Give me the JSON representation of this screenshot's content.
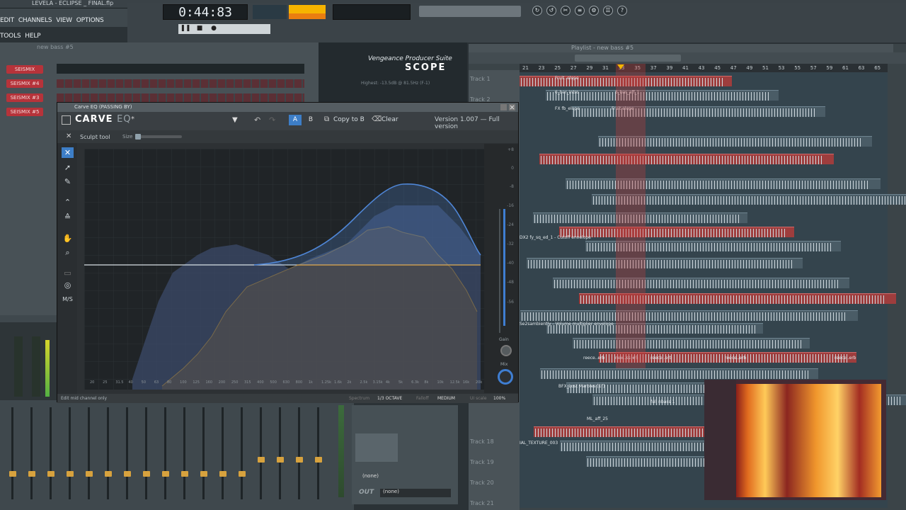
{
  "titlebar": {
    "filename": "LEVELA - ECLIPSE _ FINAL.flp"
  },
  "menu": [
    "EDIT",
    "CHANNELS",
    "VIEW",
    "OPTIONS",
    "TOOLS",
    "HELP"
  ],
  "transport": {
    "time": "0:44:83"
  },
  "channel_rack": {
    "title": "new bass #5",
    "channels": [
      "SEISMIX",
      "SEISMIX #4",
      "SEISMIX #3",
      "SEISMIX #5"
    ]
  },
  "scope": {
    "brand": "Vengeance Producer Suite",
    "name": "SCOPE",
    "readout": "Highest: -13.5dB @ 81.5Hz (F-1)"
  },
  "carve_eq": {
    "window_title": "Carve EQ (PASSING BY)",
    "logo_main": "CARVE",
    "logo_sub": "EQ",
    "preset": "*",
    "ab_a": "A",
    "ab_b": "B",
    "copy": "Copy to B",
    "clear": "Clear",
    "version": "Version 1.007 — Full version",
    "sculpt_tool": "Sculpt tool",
    "size": "Size",
    "ms_label": "M/S",
    "status": "Edit mid channel only",
    "spectrum_label": "Spectrum",
    "spectrum_value": "1/3 OCTAVE",
    "falloff_label": "Falloff",
    "falloff_value": "MEDIUM",
    "upscale_label": "UI scale",
    "upscale_value": "100%",
    "gain_label": "Gain",
    "mix_label": "Mix",
    "db_scale": [
      "+8",
      "0",
      "-8",
      "-16",
      "-24",
      "-32",
      "-40",
      "-48",
      "-56"
    ],
    "freq_labels": [
      "20",
      "25",
      "31.5",
      "40",
      "50",
      "63",
      "80",
      "100",
      "125",
      "160",
      "200",
      "250",
      "315",
      "400",
      "500",
      "630",
      "800",
      "1k",
      "1.25k",
      "1.6k",
      "2k",
      "2.5k",
      "3.15k",
      "4k",
      "5k",
      "6.3k",
      "8k",
      "10k",
      "12.5k",
      "16k",
      "20k"
    ],
    "note_labels": [
      "C1",
      "C2",
      "C3",
      "C4",
      "C5",
      "C6",
      "C7",
      "C8",
      "C9"
    ]
  },
  "playlist": {
    "title": "Playlist - new bass #5",
    "bars": [
      "21",
      "23",
      "25",
      "27",
      "29",
      "31",
      "33",
      "35",
      "37",
      "39",
      "41",
      "43",
      "45",
      "47",
      "49",
      "51",
      "53",
      "55",
      "57",
      "59",
      "61",
      "63",
      "65"
    ],
    "tracks": [
      "Track 1",
      "Track 2",
      "Track 18",
      "Track 19",
      "Track 20",
      "Track 21"
    ],
    "clip_labels": [
      "Fruit. elope",
      "6_bar_intro",
      "6_bar_aff_1",
      "FX fb_elope",
      "Fruit elope",
      "DX2 fy_sq_ed_1 - Cutoff envelope",
      "Se2sambiently - Volume multiplier envelope",
      "reece..erb",
      "new..ss #5",
      "reece..erb",
      "reece..erb",
      "reece..erb",
      "BFX_Lost Marbles [1f]",
      "full nbass 1",
      "ML_aff_25",
      "IAL_TEXTURE_003",
      "(none)",
      "OUT"
    ]
  }
}
